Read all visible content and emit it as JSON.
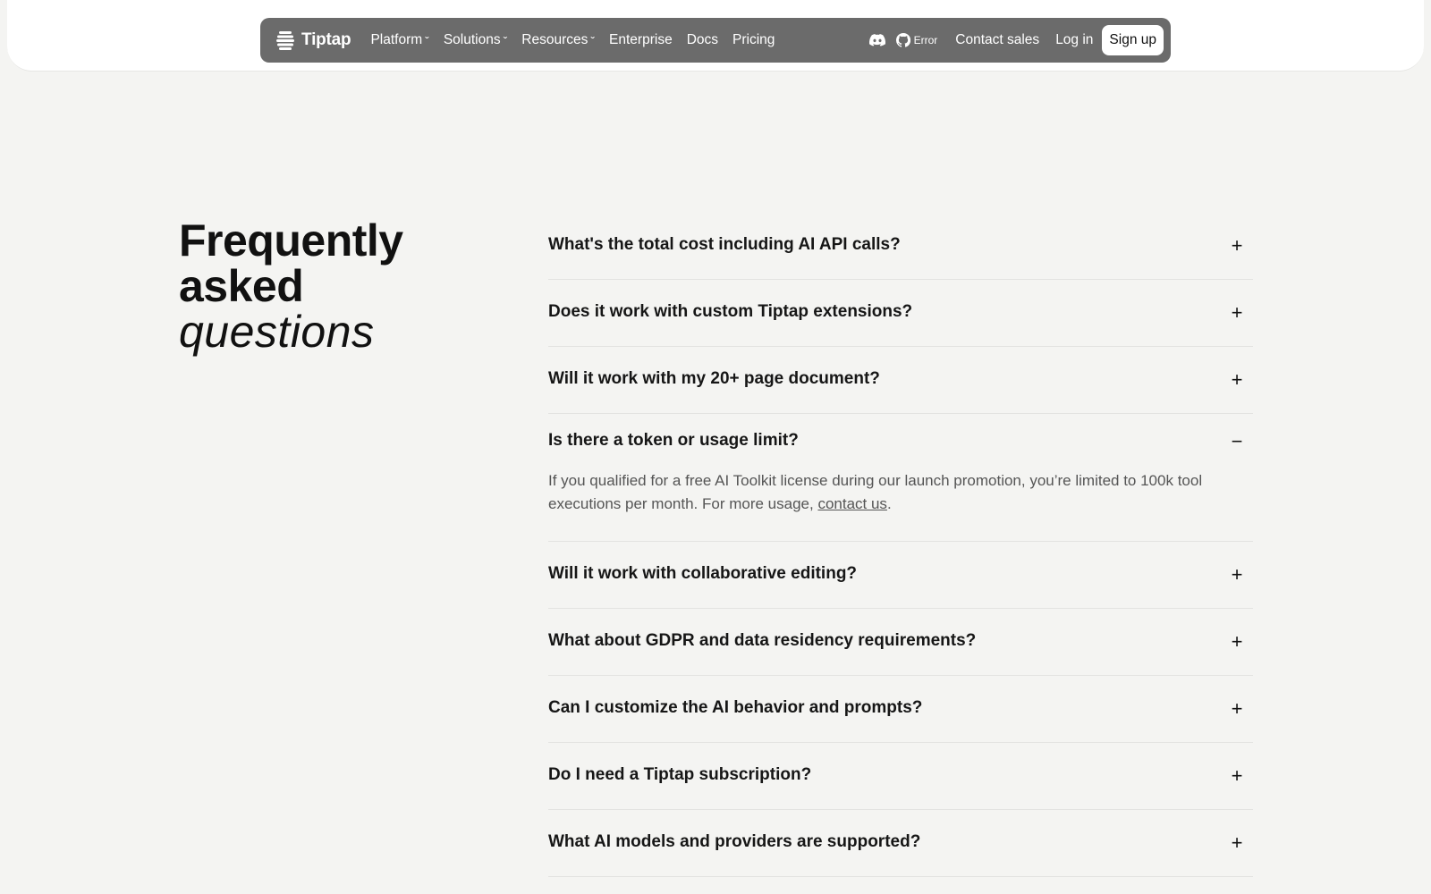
{
  "nav": {
    "brand": "Tiptap",
    "links": [
      {
        "label": "Platform",
        "dropdown": true
      },
      {
        "label": "Solutions",
        "dropdown": true
      },
      {
        "label": "Resources",
        "dropdown": true
      },
      {
        "label": "Enterprise",
        "dropdown": false
      },
      {
        "label": "Docs",
        "dropdown": false
      },
      {
        "label": "Pricing",
        "dropdown": false
      }
    ],
    "github_status": "Error",
    "contact_sales": "Contact sales",
    "login": "Log in",
    "signup": "Sign up",
    "icons": {
      "logo": "tiptap-logo-icon",
      "discord": "discord-icon",
      "github": "github-icon",
      "caret": "chevron-down-icon"
    }
  },
  "faq": {
    "title_line1": "Frequently",
    "title_line2": "asked",
    "title_line3": "questions",
    "items": [
      {
        "question": "What's the total cost including AI API calls?",
        "open": false
      },
      {
        "question": "Does it work with custom Tiptap extensions?",
        "open": false
      },
      {
        "question": "Will it work with my 20+ page document?",
        "open": false
      },
      {
        "question": "Is there a token or usage limit?",
        "open": true,
        "answer_before": "If you qualified for a free AI Toolkit license during our launch promotion, you’re limited to 100k tool executions per month. For more usage, ",
        "answer_link": "contact us",
        "answer_after": "."
      },
      {
        "question": "Will it work with collaborative editing?",
        "open": false
      },
      {
        "question": "What about GDPR and data residency requirements?",
        "open": false
      },
      {
        "question": "Can I customize the AI behavior and prompts?",
        "open": false
      },
      {
        "question": "Do I need a Tiptap subscription?",
        "open": false
      },
      {
        "question": "What AI models and providers are supported?",
        "open": false
      }
    ],
    "toggle_closed": "+",
    "toggle_open": "−"
  }
}
